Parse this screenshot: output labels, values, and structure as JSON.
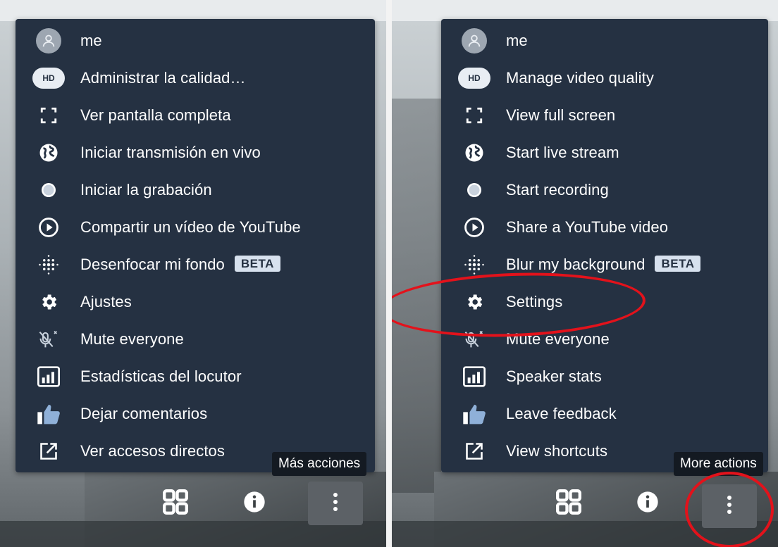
{
  "left": {
    "menu": [
      {
        "key": "profile",
        "label": "me",
        "icon": "avatar-icon"
      },
      {
        "key": "quality",
        "label": "Administrar la calidad…",
        "icon": "hd-icon"
      },
      {
        "key": "fullscreen",
        "label": "Ver pantalla completa",
        "icon": "fullscreen-icon"
      },
      {
        "key": "livestream",
        "label": "Iniciar transmisión en vivo",
        "icon": "globe-icon"
      },
      {
        "key": "recording",
        "label": "Iniciar la grabación",
        "icon": "record-icon"
      },
      {
        "key": "youtube",
        "label": "Compartir un vídeo de YouTube",
        "icon": "play-icon"
      },
      {
        "key": "blur",
        "label": "Desenfocar mi fondo",
        "icon": "blur-icon",
        "badge": "BETA"
      },
      {
        "key": "settings",
        "label": "Ajustes",
        "icon": "gear-icon"
      },
      {
        "key": "mute",
        "label": "Mute everyone",
        "icon": "mic-muted-icon"
      },
      {
        "key": "stats",
        "label": "Estadísticas del locutor",
        "icon": "stats-icon"
      },
      {
        "key": "feedback",
        "label": "Dejar comentarios",
        "icon": "thumbs-up-icon"
      },
      {
        "key": "shortcuts",
        "label": "Ver accesos directos",
        "icon": "external-link-icon"
      }
    ],
    "tooltip": "Más acciones"
  },
  "right": {
    "menu": [
      {
        "key": "profile",
        "label": "me",
        "icon": "avatar-icon"
      },
      {
        "key": "quality",
        "label": "Manage video quality",
        "icon": "hd-icon"
      },
      {
        "key": "fullscreen",
        "label": "View full screen",
        "icon": "fullscreen-icon"
      },
      {
        "key": "livestream",
        "label": "Start live stream",
        "icon": "globe-icon"
      },
      {
        "key": "recording",
        "label": "Start recording",
        "icon": "record-icon"
      },
      {
        "key": "youtube",
        "label": "Share a YouTube video",
        "icon": "play-icon"
      },
      {
        "key": "blur",
        "label": "Blur my background",
        "icon": "blur-icon",
        "badge": "BETA"
      },
      {
        "key": "settings",
        "label": "Settings",
        "icon": "gear-icon"
      },
      {
        "key": "mute",
        "label": "Mute everyone",
        "icon": "mic-muted-icon"
      },
      {
        "key": "stats",
        "label": "Speaker stats",
        "icon": "stats-icon"
      },
      {
        "key": "feedback",
        "label": "Leave feedback",
        "icon": "thumbs-up-icon"
      },
      {
        "key": "shortcuts",
        "label": "View shortcuts",
        "icon": "external-link-icon"
      }
    ],
    "tooltip": "More actions"
  },
  "hd_badge": "HD",
  "toolbar": [
    "tile-view-icon",
    "info-icon",
    "more-vertical-icon"
  ],
  "colors": {
    "menu_bg": "#253142",
    "text": "#ffffff",
    "badge_bg": "#d7e1ee",
    "annotation": "#e3121b",
    "active_button": "#5c6166"
  }
}
